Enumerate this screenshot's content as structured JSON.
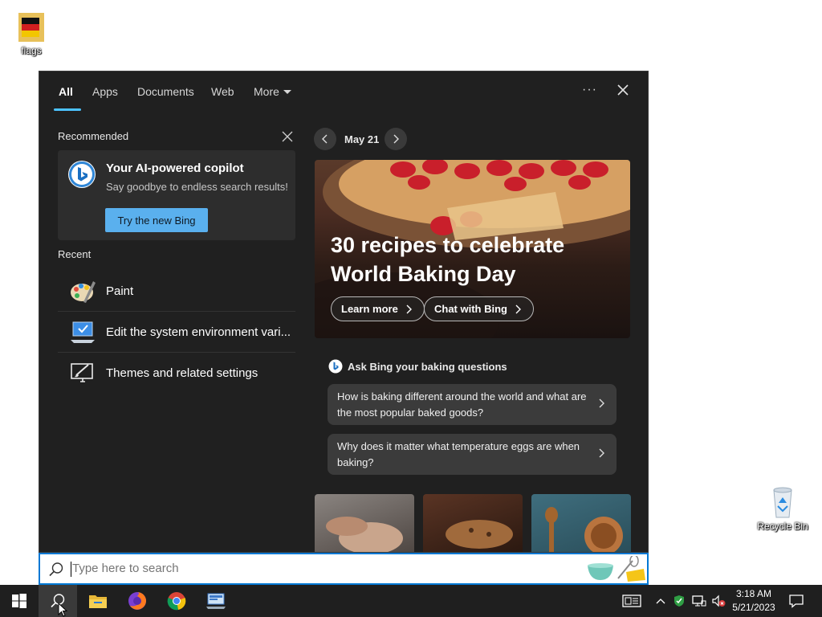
{
  "desktop": {
    "icons": [
      {
        "label": "flags",
        "icon": "germany-flag-folder-icon"
      },
      {
        "label": "Recycle Bin",
        "icon": "recycle-bin-icon"
      }
    ]
  },
  "search_panel": {
    "tabs": [
      {
        "label": "All",
        "active": true
      },
      {
        "label": "Apps"
      },
      {
        "label": "Documents"
      },
      {
        "label": "Web"
      },
      {
        "label": "More"
      }
    ],
    "more_options_label": "···",
    "recommended": {
      "heading": "Recommended",
      "card": {
        "title": "Your AI-powered copilot",
        "subtitle": "Say goodbye to endless search results!",
        "button": "Try the new Bing"
      }
    },
    "recent": {
      "heading": "Recent",
      "items": [
        {
          "label": "Paint",
          "icon": "paint-icon"
        },
        {
          "label": "Edit the system environment vari...",
          "icon": "system-properties-icon"
        },
        {
          "label": "Themes and related settings",
          "icon": "themes-icon"
        }
      ]
    },
    "highlights": {
      "date": "May 21",
      "hero_title": "30 recipes to celebrate World Baking Day",
      "learn_more": "Learn more",
      "chat_with_bing": "Chat with Bing",
      "ask_heading": "Ask Bing your baking questions",
      "questions": [
        "How is baking different around the world and what are the most popular baked goods?",
        "Why does it matter what temperature eggs are when baking?"
      ]
    }
  },
  "search_bar": {
    "placeholder": "Type here to search"
  },
  "taskbar": {
    "apps": [
      "start-icon",
      "search-icon",
      "file-explorer-icon",
      "firefox-icon",
      "chrome-icon",
      "network-app-icon"
    ],
    "clock_time": "3:18 AM",
    "clock_date": "5/21/2023"
  },
  "colors": {
    "accent": "#0078d4",
    "tab_underline": "#4cc2ff",
    "bing_button": "#5ab0ee",
    "panel_bg": "#202020"
  }
}
